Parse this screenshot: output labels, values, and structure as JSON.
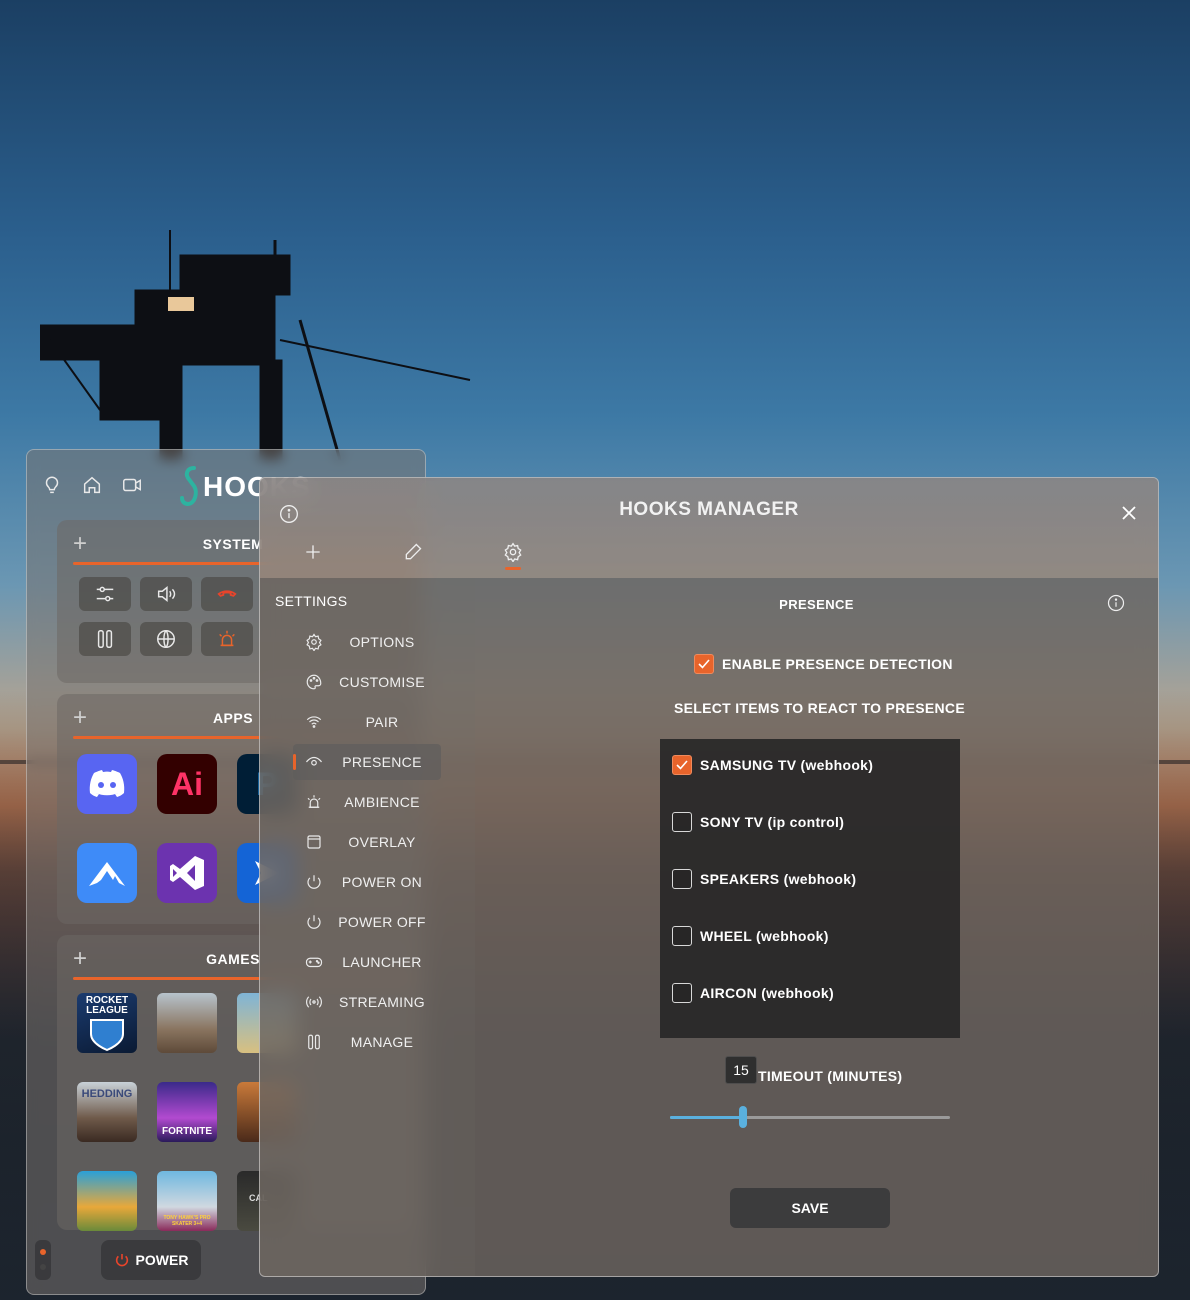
{
  "hooks_window": {
    "logo_text": "HOOKS",
    "top_icons": [
      "bulb-icon",
      "home-icon",
      "camera-icon"
    ],
    "sections": {
      "system": {
        "title": "SYSTEM"
      },
      "apps": {
        "title": "APPS",
        "tiles": [
          {
            "name": "discord-app",
            "label": "",
            "color": "#5865f2"
          },
          {
            "name": "illustrator-app",
            "label": "Ai",
            "color": "#330000"
          },
          {
            "name": "photoshop-app",
            "label": "P",
            "color": "#001e36"
          },
          {
            "name": "nordvpn-app",
            "label": "",
            "color": "#3e8bf8"
          },
          {
            "name": "visual-studio-app",
            "label": "",
            "color": "#6c33af"
          },
          {
            "name": "remote-desktop-app",
            "label": "",
            "color": "#1464d6"
          }
        ]
      },
      "games": {
        "title": "GAMES",
        "tiles": [
          {
            "name": "rocket-league-game",
            "label": "ROCKET LEAGUE"
          },
          {
            "name": "dune-game",
            "label": ""
          },
          {
            "name": "game-3",
            "label": ""
          },
          {
            "name": "hedding-game",
            "label": "HEDDING"
          },
          {
            "name": "fortnite-game",
            "label": "FORTNITE"
          },
          {
            "name": "game-6",
            "label": ""
          },
          {
            "name": "game-7",
            "label": ""
          },
          {
            "name": "tony-hawk-game",
            "label": "TONY HAWK'S PRO SKATER 3+4"
          },
          {
            "name": "call-of-duty-game",
            "label": "CAL"
          }
        ]
      }
    },
    "power_label": "POWER"
  },
  "manager": {
    "title": "HOOKS MANAGER",
    "sidebar_title": "SETTINGS",
    "nav": [
      {
        "id": "options",
        "label": "OPTIONS",
        "icon": "gear-icon"
      },
      {
        "id": "customise",
        "label": "CUSTOMISE",
        "icon": "palette-icon"
      },
      {
        "id": "pair",
        "label": "PAIR",
        "icon": "wifi-icon"
      },
      {
        "id": "presence",
        "label": "PRESENCE",
        "icon": "eye-icon",
        "active": true
      },
      {
        "id": "ambience",
        "label": "AMBIENCE",
        "icon": "alarm-light-icon"
      },
      {
        "id": "overlay",
        "label": "OVERLAY",
        "icon": "window-icon"
      },
      {
        "id": "power-on",
        "label": "POWER ON",
        "icon": "power-icon"
      },
      {
        "id": "power-off",
        "label": "POWER OFF",
        "icon": "power-icon"
      },
      {
        "id": "launcher",
        "label": "LAUNCHER",
        "icon": "gamepad-icon"
      },
      {
        "id": "streaming",
        "label": "STREAMING",
        "icon": "broadcast-icon"
      },
      {
        "id": "manage",
        "label": "MANAGE",
        "icon": "tools-icon"
      }
    ],
    "panel": {
      "title": "PRESENCE",
      "enable_label": "ENABLE PRESENCE DETECTION",
      "enable_checked": true,
      "select_label": "SELECT ITEMS TO REACT TO PRESENCE",
      "items": [
        {
          "label": "SAMSUNG TV (webhook)",
          "checked": true
        },
        {
          "label": "SONY TV (ip control)",
          "checked": false
        },
        {
          "label": "SPEAKERS (webhook)",
          "checked": false
        },
        {
          "label": "WHEEL (webhook)",
          "checked": false
        },
        {
          "label": "AIRCON (webhook)",
          "checked": false
        }
      ],
      "timeout_label": "TIMEOUT (MINUTES)",
      "timeout_value": "15",
      "timeout_fraction": 0.26,
      "save_label": "SAVE"
    }
  },
  "colors": {
    "accent": "#e8642b",
    "slider": "#5ab0de",
    "teal_logo": "#2db3a0"
  }
}
